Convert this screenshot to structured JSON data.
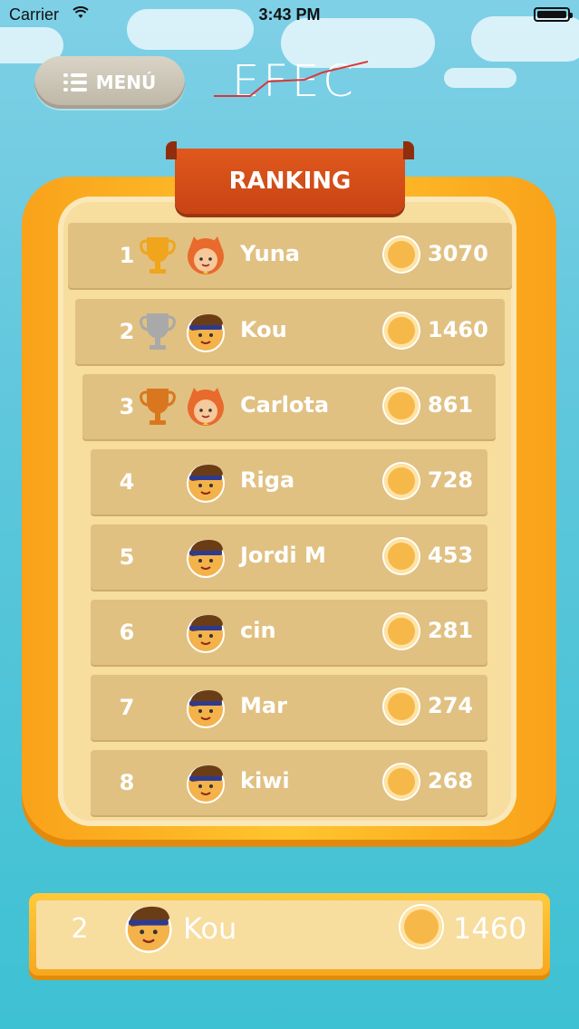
{
  "status": {
    "carrier": "Carrier",
    "time": "3:43 PM"
  },
  "header": {
    "menu_label": "MENÚ",
    "logo_text": "EFEC"
  },
  "ranking": {
    "title": "RANKING",
    "rows": [
      {
        "rank": "1",
        "trophy": "gold-trophy",
        "avatar": "cat-girl-avatar",
        "name": "Yuna",
        "score": "3070"
      },
      {
        "rank": "2",
        "trophy": "silver-trophy",
        "avatar": "boy-avatar",
        "name": "Kou",
        "score": "1460"
      },
      {
        "rank": "3",
        "trophy": "bronze-trophy",
        "avatar": "cat-girl-avatar",
        "name": "Carlota",
        "score": "861"
      },
      {
        "rank": "4",
        "trophy": "",
        "avatar": "boy-avatar",
        "name": "Riga",
        "score": "728"
      },
      {
        "rank": "5",
        "trophy": "",
        "avatar": "boy-avatar",
        "name": "Jordi M",
        "score": "453"
      },
      {
        "rank": "6",
        "trophy": "",
        "avatar": "boy-avatar",
        "name": "cin",
        "score": "281"
      },
      {
        "rank": "7",
        "trophy": "",
        "avatar": "boy-avatar",
        "name": "Mar",
        "score": "274"
      },
      {
        "rank": "8",
        "trophy": "",
        "avatar": "boy-avatar",
        "name": "kiwi",
        "score": "268"
      }
    ]
  },
  "current_user": {
    "rank": "2",
    "avatar": "boy-avatar",
    "name": "Kou",
    "score": "1460"
  },
  "colors": {
    "gold": "#f0a51c",
    "silver": "#a9a9a9",
    "bronze": "#d9771f",
    "accent": "#d04d17"
  }
}
